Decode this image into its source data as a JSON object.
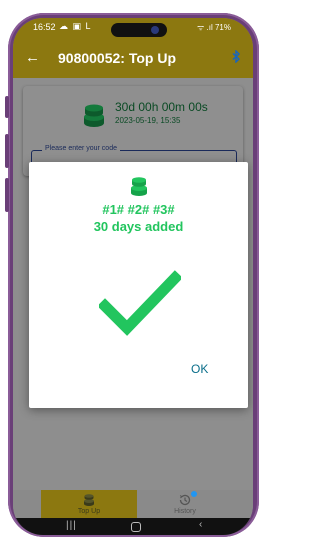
{
  "status_bar": {
    "time": "16:52",
    "left_icons": "☁ ▣ L",
    "right_text": "ᯤ .ıl 71%"
  },
  "app_bar": {
    "title": "90800052: Top Up"
  },
  "card": {
    "remaining": "30d 00h 00m 00s",
    "date": "2023-05-19, 15:35",
    "code_placeholder": "Please enter your code"
  },
  "dialog": {
    "codes": "#1# #2# #3#",
    "message": "30 days added",
    "ok_label": "OK"
  },
  "bottom_nav": {
    "tabs": [
      {
        "label": "Top Up"
      },
      {
        "label": "History"
      }
    ]
  },
  "system_nav": {
    "recent": "|||",
    "back": "‹"
  },
  "colors": {
    "accent_bar": "#8c7810",
    "success_green": "#22c55e",
    "ok_teal": "#0a6e8a",
    "bluetooth_blue": "#1565c0",
    "phone_frame": "#6a3f78"
  }
}
